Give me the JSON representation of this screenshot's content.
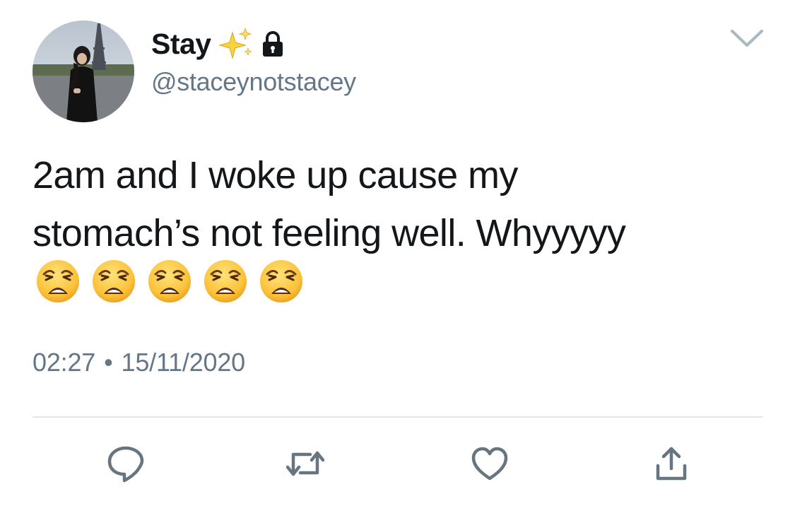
{
  "tweet": {
    "author": {
      "display_name": "Stay",
      "handle": "@staceynotstacey",
      "name_badges": [
        "sparkles-icon",
        "lock-icon"
      ],
      "avatar": "avatar"
    },
    "text": "2am and I woke up cause my\nstomach’s not feeling well. Whyyyyy",
    "emojis": [
      "weary-face-icon",
      "weary-face-icon",
      "weary-face-icon",
      "weary-face-icon",
      "weary-face-icon"
    ],
    "time": "02:27",
    "separator": "•",
    "date": "15/11/2020",
    "menu_icon": "chevron-down-icon"
  },
  "actions": [
    "reply-icon",
    "retweet-icon",
    "like-icon",
    "share-icon"
  ],
  "colors": {
    "text": "#14171a",
    "secondary": "#657786",
    "divider": "#e1e8ed",
    "icon": "#66757f"
  }
}
